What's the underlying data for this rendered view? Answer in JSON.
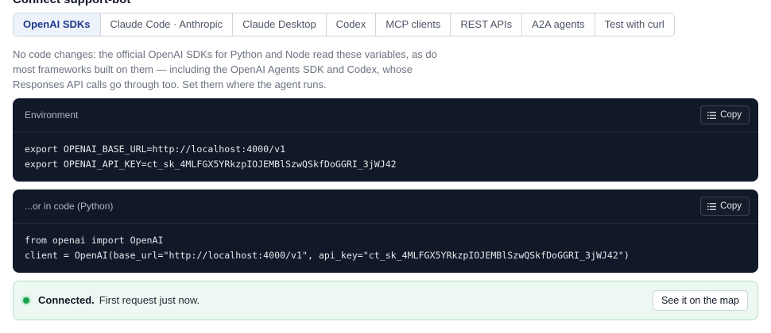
{
  "page": {
    "title": "Connect support-bot"
  },
  "tabs": [
    {
      "label": "OpenAI SDKs",
      "active": true
    },
    {
      "label": "Claude Code · Anthropic"
    },
    {
      "label": "Claude Desktop"
    },
    {
      "label": "Codex"
    },
    {
      "label": "MCP clients"
    },
    {
      "label": "REST APIs"
    },
    {
      "label": "A2A agents"
    },
    {
      "label": "Test with curl"
    }
  ],
  "intro": "No code changes: the official OpenAI SDKs for Python and Node read these variables, as do most frameworks built on them — including the OpenAI Agents SDK and Codex, whose Responses API calls go through too. Set them where the agent runs.",
  "env_block": {
    "title": "Environment",
    "copy_label": "Copy",
    "lines": [
      "export OPENAI_BASE_URL=http://localhost:4000/v1",
      "export OPENAI_API_KEY=ct_sk_4MLFGX5YRkzpIOJEMBlSzwQSkfDoGGRI_3jWJ42"
    ]
  },
  "code_block": {
    "title": "...or in code (Python)",
    "copy_label": "Copy",
    "lines": [
      "from openai import OpenAI",
      "client = OpenAI(base_url=\"http://localhost:4000/v1\", api_key=\"ct_sk_4MLFGX5YRkzpIOJEMBlSzwQSkfDoGGRI_3jWJ42\")"
    ]
  },
  "status": {
    "label": "Connected.",
    "detail": "First request just now.",
    "action": "See it on the map",
    "color": "#16a34a"
  },
  "icons": {
    "copy": "list-icon",
    "status": "status-dot"
  },
  "colors": {
    "accent": "#1e3a8a",
    "code_bg": "#111827",
    "success_bg": "#ecf8f1"
  }
}
